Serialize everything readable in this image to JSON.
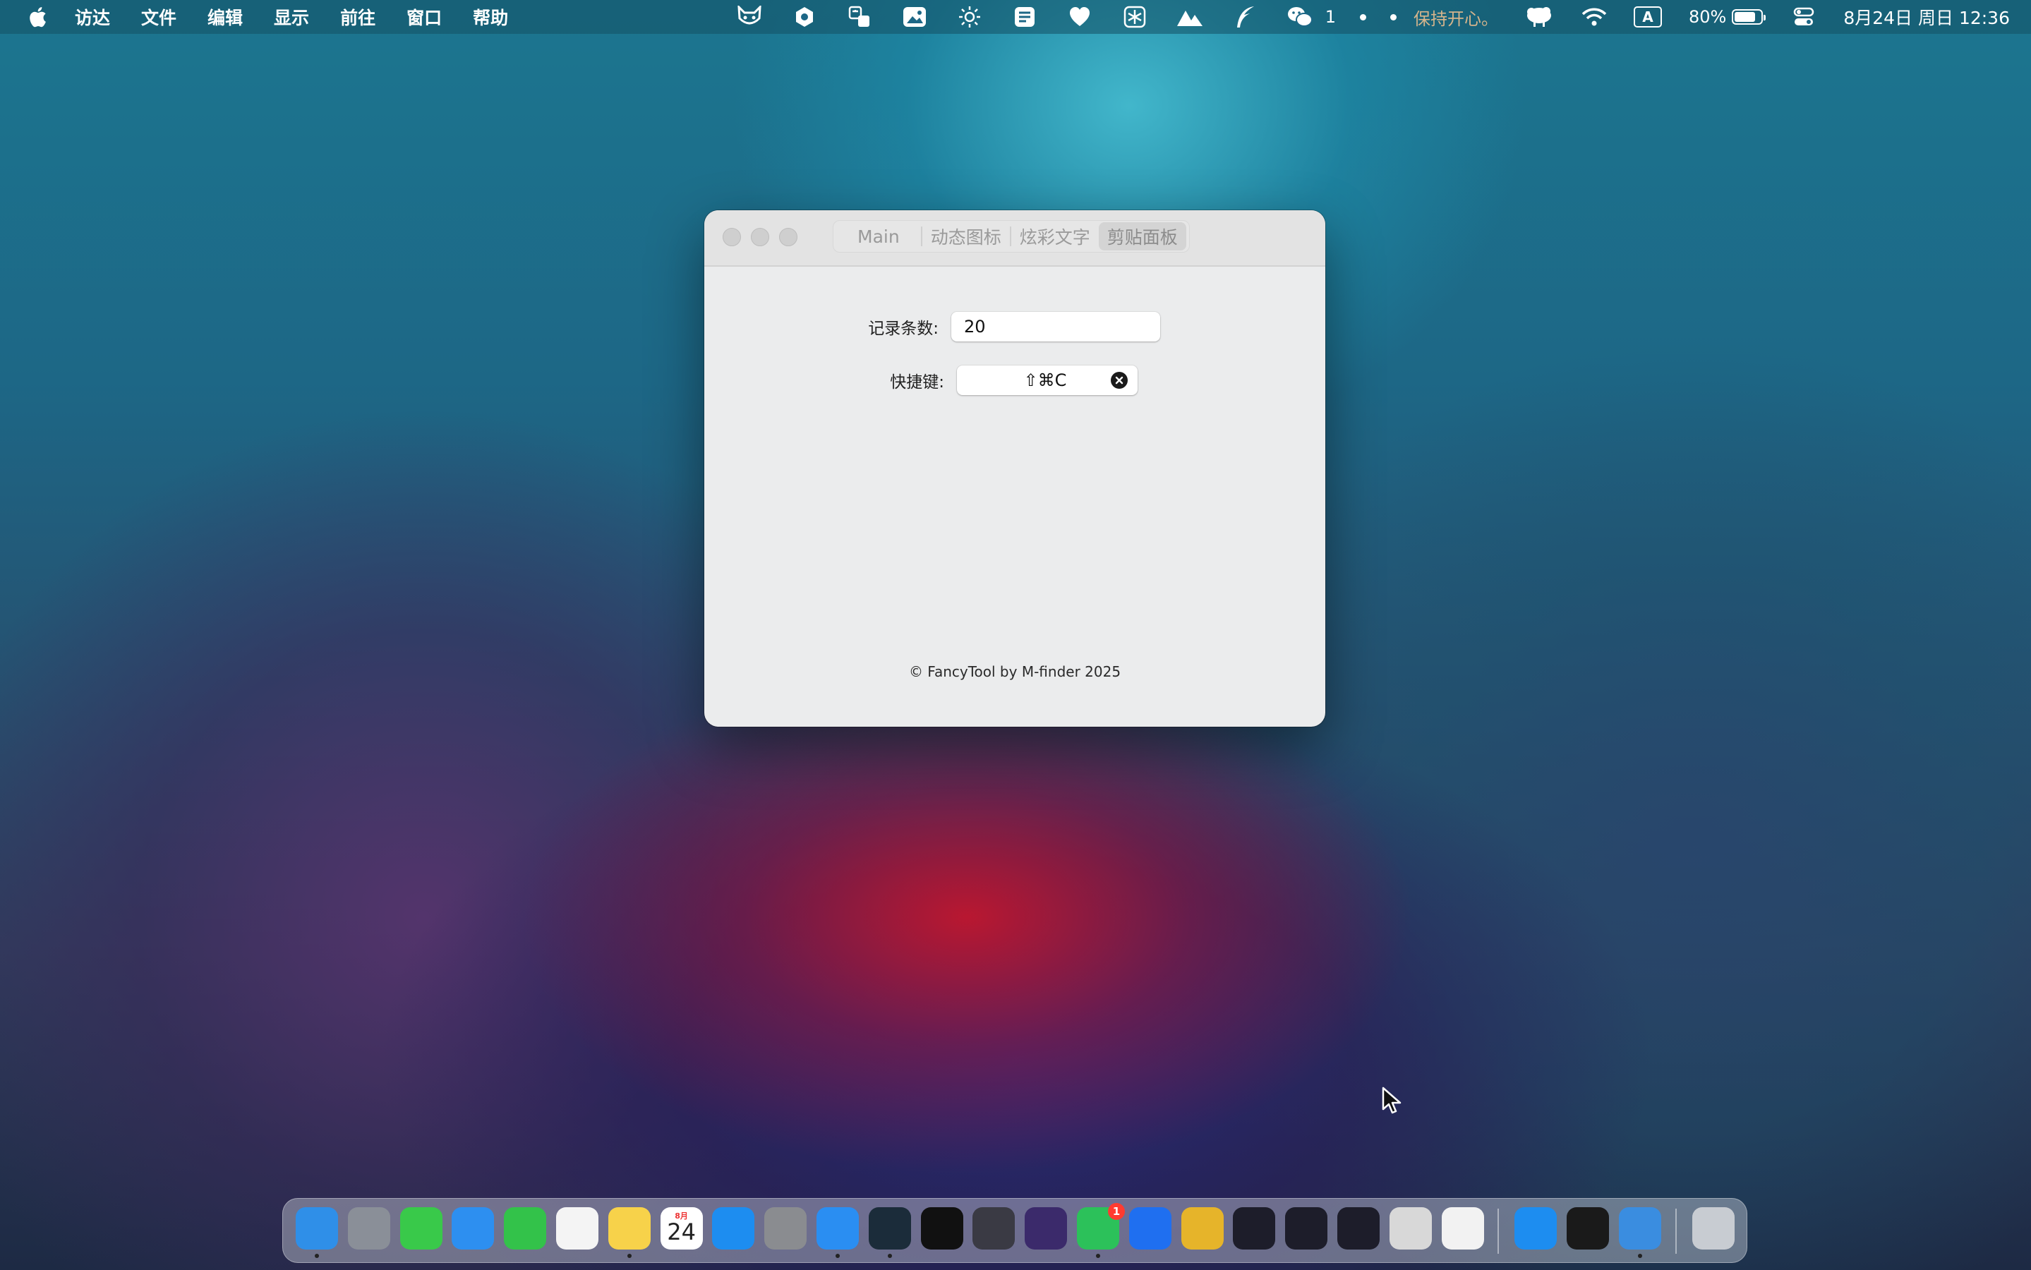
{
  "menubar": {
    "items": [
      "访达",
      "文件",
      "编辑",
      "显示",
      "前往",
      "窗口",
      "帮助"
    ],
    "status": {
      "wechat_count": "1",
      "keep_happy": "保持开心。",
      "input_method": "A",
      "battery_percent": "80%",
      "battery_level": 0.8,
      "date_time": "8月24日 周日  12:36"
    }
  },
  "window": {
    "tabs": [
      "Main",
      "动态图标",
      "炫彩文字",
      "剪贴面板"
    ],
    "active_tab": "剪贴面板",
    "record_count_label": "记录条数:",
    "record_count_value": "20",
    "hotkey_label": "快捷键:",
    "hotkey_value": "⇧⌘C",
    "footer": "© FancyTool by M-finder 2025"
  },
  "dock": {
    "calendar_month": "8月",
    "calendar_day": "24",
    "wechat_badge": "1",
    "apps": [
      {
        "name": "finder",
        "color": "#2f8fe8"
      },
      {
        "name": "launchpad",
        "color": "#8a8f98"
      },
      {
        "name": "messages",
        "color": "#39c94a"
      },
      {
        "name": "mail",
        "color": "#2d8ff0"
      },
      {
        "name": "facetime",
        "color": "#33c24a"
      },
      {
        "name": "reminders",
        "color": "#f4f4f4"
      },
      {
        "name": "notes",
        "color": "#f7d24a"
      },
      {
        "name": "calendar",
        "color": "#ffffff"
      },
      {
        "name": "app-store",
        "color": "#1d8df0"
      },
      {
        "name": "system-settings",
        "color": "#8a8c90"
      },
      {
        "name": "safari",
        "color": "#2a8ef2"
      },
      {
        "name": "cloud-app",
        "color": "#1b2c3a"
      },
      {
        "name": "cat-app",
        "color": "#111111"
      },
      {
        "name": "activity-app",
        "color": "#3a3a44"
      },
      {
        "name": "obsidian",
        "color": "#3b2a6b"
      },
      {
        "name": "wechat",
        "color": "#2cc15a"
      },
      {
        "name": "maps-pin",
        "color": "#1f6ff0"
      },
      {
        "name": "navicat",
        "color": "#e6b42a"
      },
      {
        "name": "phpstorm",
        "color": "#1d1d2a"
      },
      {
        "name": "intellij",
        "color": "#1d1d2a"
      },
      {
        "name": "webstorm",
        "color": "#1d1d2a"
      },
      {
        "name": "script-editor",
        "color": "#d8d8d8"
      },
      {
        "name": "exclaim-app",
        "color": "#f2f2f2"
      },
      {
        "name": "xcode-appstore",
        "color": "#1d8df0"
      },
      {
        "name": "activity-monitor",
        "color": "#1a1a1a"
      },
      {
        "name": "xcode",
        "color": "#3a8de0"
      },
      {
        "name": "trash",
        "color": "#c8ccd2"
      }
    ]
  }
}
